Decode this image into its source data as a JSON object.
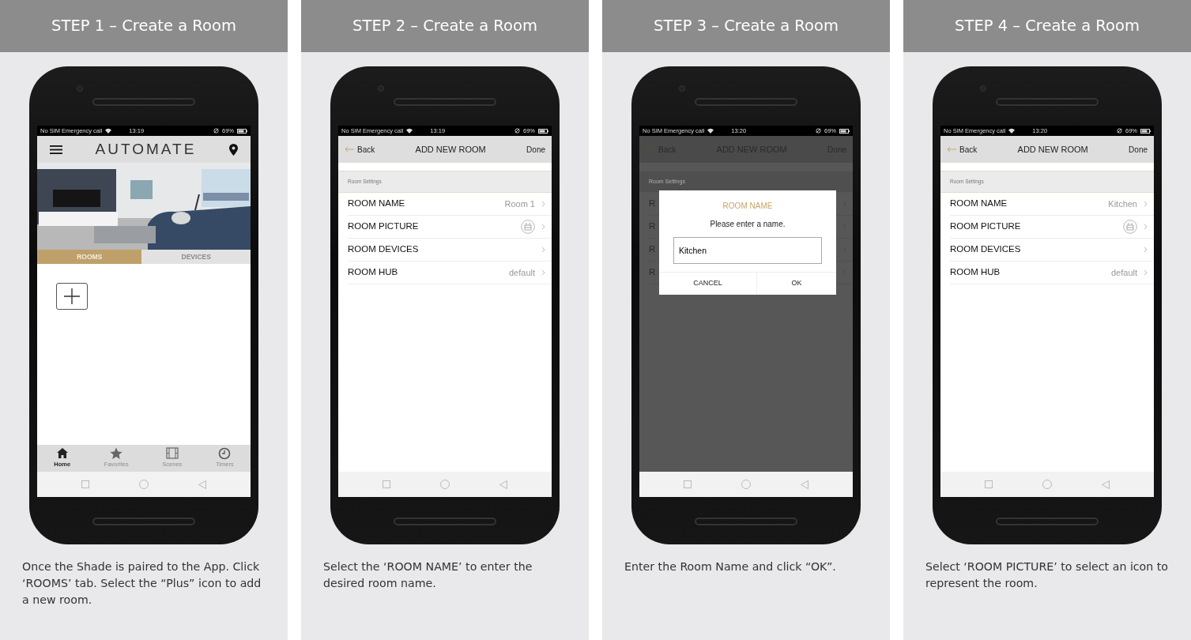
{
  "steps": [
    {
      "title": "STEP 1 – Create a Room",
      "caption": "Once the Shade is paired to the App. Click ‘ROOMS’ tab. Select the “Plus” icon to add a new room.",
      "screen": {
        "kind": "home",
        "status": {
          "carrier": "No SIM  Emergency call",
          "time": "13:19",
          "battery": "69%"
        },
        "logo": "AUTOMATE",
        "tabs": [
          {
            "label": "ROOMS",
            "selected": true
          },
          {
            "label": "DEVICES",
            "selected": false
          }
        ],
        "nav": [
          {
            "label": "Home",
            "selected": true
          },
          {
            "label": "Favorites",
            "selected": false
          },
          {
            "label": "Scenes",
            "selected": false
          },
          {
            "label": "Timers",
            "selected": false
          }
        ]
      }
    },
    {
      "title": "STEP 2 – Create a Room",
      "caption": "Select the ‘ROOM NAME’ to enter the desired room name.",
      "screen": {
        "kind": "form",
        "status": {
          "carrier": "No SIM  Emergency call",
          "time": "13:19",
          "battery": "69%"
        },
        "back": "Back",
        "heading": "ADD NEW ROOM",
        "done": "Done",
        "section": "Room Settings",
        "rows": [
          {
            "kind": "value",
            "label": "ROOM NAME",
            "value": "Room 1"
          },
          {
            "kind": "picture",
            "label": "ROOM PICTURE"
          },
          {
            "kind": "plain",
            "label": "ROOM DEVICES"
          },
          {
            "kind": "value",
            "label": "ROOM HUB",
            "value": "default"
          }
        ]
      }
    },
    {
      "title": "STEP 3 – Create a Room",
      "caption": "Enter the Room Name and click “OK”.",
      "screen": {
        "kind": "form",
        "dimmed": true,
        "status": {
          "carrier": "No SIM  Emergency call",
          "time": "13:20",
          "battery": "69%"
        },
        "back": "Back",
        "heading": "ADD NEW ROOM",
        "done": "Done",
        "section": "Room Settings",
        "rows": [
          {
            "kind": "plain",
            "label": "R"
          },
          {
            "kind": "plain",
            "label": "R"
          },
          {
            "kind": "plain",
            "label": "R"
          },
          {
            "kind": "plain",
            "label": "R"
          }
        ],
        "dialog": {
          "title": "ROOM NAME",
          "message": "Please enter a name.",
          "value": "Kitchen",
          "buttons": [
            "CANCEL",
            "OK"
          ]
        }
      }
    },
    {
      "title": "STEP 4 – Create a Room",
      "caption": "Select ‘ROOM PICTURE’ to select an icon to represent the room.",
      "screen": {
        "kind": "form",
        "status": {
          "carrier": "No SIM  Emergency call",
          "time": "13:20",
          "battery": "69%"
        },
        "back": "Back",
        "heading": "ADD NEW ROOM",
        "done": "Done",
        "section": "Room Settings",
        "rows": [
          {
            "kind": "value",
            "label": "ROOM NAME",
            "value": "Kitchen"
          },
          {
            "kind": "picture",
            "label": "ROOM PICTURE"
          },
          {
            "kind": "plain",
            "label": "ROOM DEVICES"
          },
          {
            "kind": "value",
            "label": "ROOM HUB",
            "value": "default"
          }
        ]
      }
    }
  ]
}
